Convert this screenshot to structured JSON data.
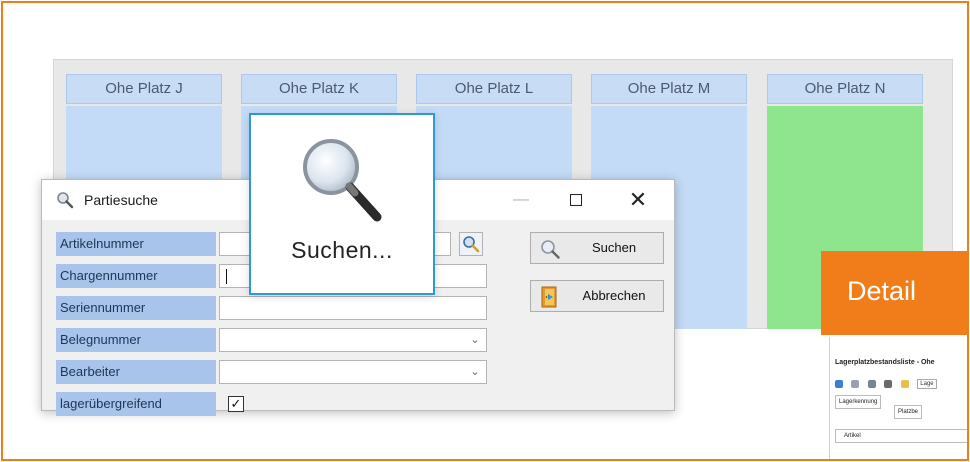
{
  "board": {
    "places": [
      {
        "label": "Ohe Platz J",
        "color": "#c4dbf7"
      },
      {
        "label": "Ohe Platz K",
        "color": "#c4dbf7"
      },
      {
        "label": "Ohe Platz L",
        "color": "#c4dbf7"
      },
      {
        "label": "Ohe Platz M",
        "color": "#c4dbf7"
      },
      {
        "label": "Ohe Platz N",
        "color": "#8ee58e"
      }
    ]
  },
  "dialog": {
    "title": "Partiesuche",
    "title_icon": "magnifier-icon",
    "fields": [
      {
        "label": "Artikelnummer",
        "value": "",
        "type": "text-search"
      },
      {
        "label": "Chargennummer",
        "value": "",
        "type": "text",
        "focused": true
      },
      {
        "label": "Seriennummer",
        "value": "",
        "type": "text"
      },
      {
        "label": "Belegnummer",
        "value": "",
        "type": "dropdown"
      },
      {
        "label": "Bearbeiter",
        "value": "",
        "type": "dropdown"
      },
      {
        "label": "lagerübergreifend",
        "checked": true,
        "type": "checkbox"
      }
    ],
    "buttons": {
      "search": "Suchen",
      "cancel": "Abbrechen"
    },
    "window_controls": {
      "minimize": "—",
      "close": "✕"
    }
  },
  "zoom_tooltip": {
    "text": "Suchen..."
  },
  "detail": {
    "banner": "Detail",
    "screenshot": {
      "title": "Lagerplatzbestandsliste - Ohe",
      "toolbar_field": "Lage",
      "col_header_1": "Lagerkennung",
      "col_header_2": "Platzbe",
      "row_label": "Artikel"
    }
  },
  "colors": {
    "accent": "#f07d19",
    "label_bg": "#a8c4eb",
    "tooltip_border": "#2d9ad6"
  }
}
